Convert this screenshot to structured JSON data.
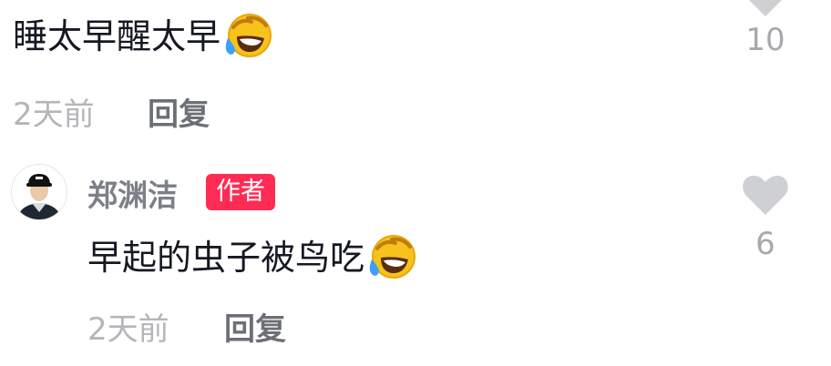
{
  "comments": [
    {
      "text": "睡太早醒太早",
      "emoji": "laughing-tears-face",
      "likes": "10",
      "time": "2天前",
      "reply_label": "回复"
    },
    {
      "author": "郑渊洁",
      "author_badge": "作者",
      "text": "早起的虫子被鸟吃",
      "emoji": "laughing-tears-face",
      "likes": "6",
      "time": "2天前",
      "reply_label": "回复"
    }
  ],
  "colors": {
    "badge_bg": "#fe2c55",
    "heart": "#cfd0d3",
    "primary_text": "#161823",
    "secondary_text": "#b4b6ba"
  }
}
